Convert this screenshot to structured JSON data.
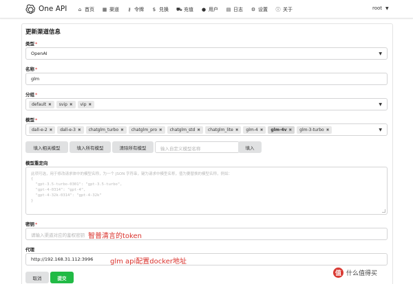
{
  "app": {
    "brand": "One API"
  },
  "nav": {
    "items": [
      {
        "icon": "home-icon",
        "glyph": "⌂",
        "label": "首页"
      },
      {
        "icon": "grid-icon",
        "glyph": "▦",
        "label": "渠道"
      },
      {
        "icon": "key-icon",
        "glyph": "⚷",
        "label": "令牌"
      },
      {
        "icon": "dollar-icon",
        "glyph": "$",
        "label": "兑换"
      },
      {
        "icon": "cart-icon",
        "glyph": "⛟",
        "label": "充值"
      },
      {
        "icon": "user-icon",
        "glyph": "●",
        "label": "用户"
      },
      {
        "icon": "calendar-icon",
        "glyph": "▤",
        "label": "日志"
      },
      {
        "icon": "gear-icon",
        "glyph": "⚙",
        "label": "设置"
      },
      {
        "icon": "info-icon",
        "glyph": "ⓘ",
        "label": "关于"
      }
    ],
    "user": "root"
  },
  "form": {
    "title": "更新渠道信息",
    "type": {
      "label": "类型",
      "value": "OpenAI"
    },
    "name": {
      "label": "名称",
      "value": "glm"
    },
    "group": {
      "label": "分组",
      "chips": [
        "default",
        "svip",
        "vip"
      ]
    },
    "models": {
      "label": "模型",
      "chips": [
        "dall-e-2",
        "dall-e-3",
        "chatglm_turbo",
        "chatglm_pro",
        "chatglm_std",
        "chatglm_lite",
        "glm-4",
        "glm-4v",
        "glm-3-turbo"
      ],
      "selected": "glm-4v"
    },
    "buttons": {
      "fill_related": "填入相关模型",
      "fill_all": "填入所有模型",
      "clear_all": "清除所有模型",
      "custom_placeholder": "输入自定义模型名称",
      "fill": "填入"
    },
    "mapping": {
      "label": "模型重定向",
      "lines": [
        "此项可选，用于修改请求体中的模型名称，为一个 JSON 字符串，键为请求中模型名称，值为要替换的模型名称，例如：",
        "{",
        "  \"gpt-3.5-turbo-0301\": \"gpt-3.5-turbo\",",
        "  \"gpt-4-0314\": \"gpt-4\",",
        "  \"gpt-4-32k-0314\": \"gpt-4-32k\"",
        "}"
      ]
    },
    "key": {
      "label": "密钥",
      "placeholder": "请输入渠道对应的鉴权密钥"
    },
    "proxy": {
      "label": "代理",
      "value": "http://192.168.31.112:3996"
    },
    "cancel": "取消",
    "submit": "提交"
  },
  "annotations": {
    "key_note": "智普清言的token",
    "proxy_note": "glm api配置docker地址"
  },
  "watermark": {
    "glyph": "值",
    "text": "什么值得买"
  },
  "colors": {
    "submit": "#21ba45",
    "annotation": "#d9312b"
  }
}
